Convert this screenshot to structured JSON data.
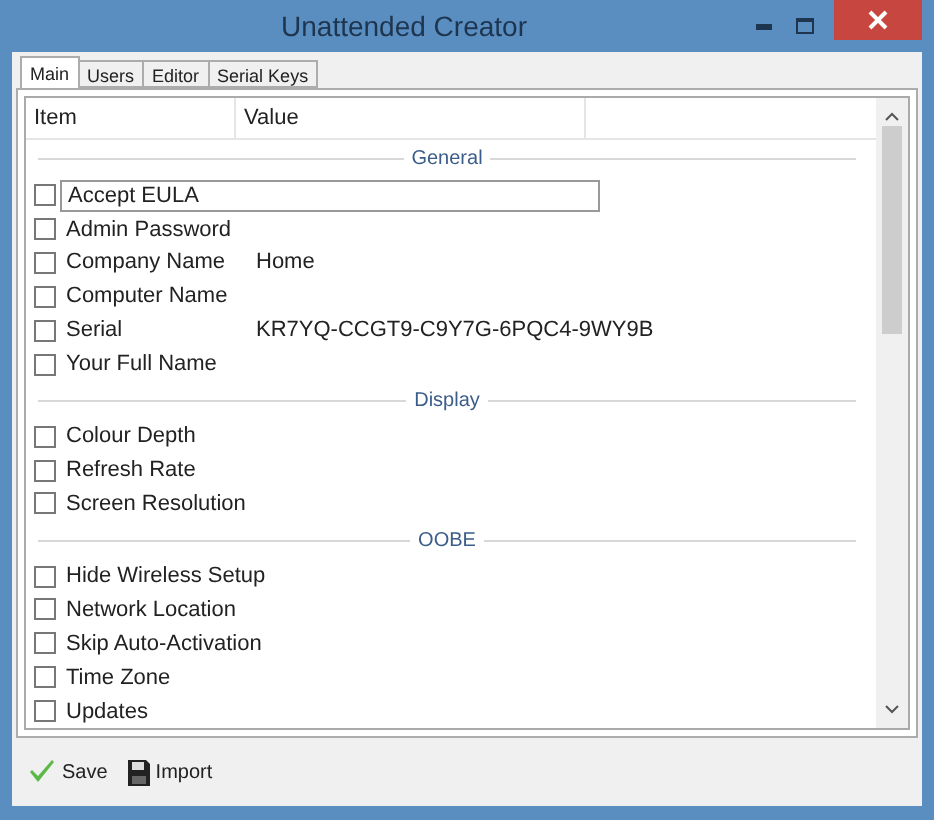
{
  "window": {
    "title": "Unattended Creator"
  },
  "tabs": [
    {
      "label": "Main",
      "selected": true
    },
    {
      "label": "Users",
      "selected": false
    },
    {
      "label": "Editor",
      "selected": false
    },
    {
      "label": "Serial Keys",
      "selected": false
    }
  ],
  "columns": [
    "Item",
    "Value"
  ],
  "groups": [
    {
      "title": "General",
      "items": [
        {
          "label": "Accept EULA",
          "checked": false,
          "focused": true
        },
        {
          "label": "Admin Password",
          "checked": false,
          "focused": false
        },
        {
          "label": "Company Name",
          "value": "Home",
          "checked": false,
          "focused": false
        },
        {
          "label": "Computer Name",
          "checked": false,
          "focused": false
        },
        {
          "label": "Serial",
          "value": "KR7YQ-CCGT9-C9Y7G-6PQC4-9WY9B",
          "checked": false,
          "focused": false
        },
        {
          "label": "Your Full Name",
          "checked": false,
          "focused": false
        }
      ]
    },
    {
      "title": "Display",
      "items": [
        {
          "label": "Colour Depth",
          "checked": false,
          "focused": false
        },
        {
          "label": "Refresh Rate",
          "checked": false,
          "focused": false
        },
        {
          "label": "Screen Resolution",
          "checked": false,
          "focused": false
        }
      ]
    },
    {
      "title": "OOBE",
      "items": [
        {
          "label": "Hide Wireless Setup",
          "checked": false,
          "focused": false
        },
        {
          "label": "Network Location",
          "checked": false,
          "focused": false
        },
        {
          "label": "Skip Auto-Activation",
          "checked": false,
          "focused": false
        },
        {
          "label": "Time Zone",
          "checked": false,
          "focused": false
        },
        {
          "label": "Updates",
          "checked": false,
          "focused": false
        }
      ]
    }
  ],
  "toolbar": [
    {
      "label": "Save",
      "kind": "save"
    },
    {
      "label": "Import",
      "kind": "import"
    }
  ]
}
